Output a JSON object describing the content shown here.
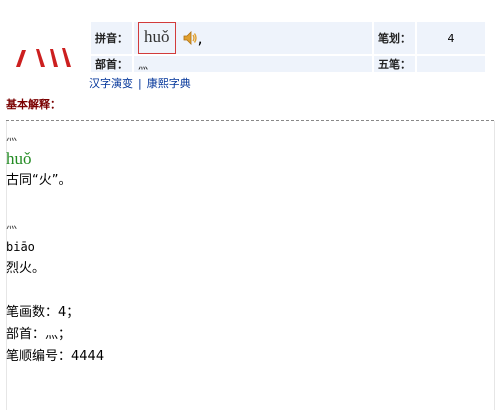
{
  "header": {
    "glyph_color": "#cc1f1f",
    "pinyin_label": "拼音：",
    "pinyin_value": "huǒ",
    "pinyin_suffix": ",",
    "bihua_label": "笔划：",
    "bihua_value": "4",
    "bushou_label": "部首：",
    "bushou_value": "灬",
    "wubi_label": "五笔：",
    "wubi_value": ""
  },
  "links": {
    "evolution": "汉字演变",
    "separator": "|",
    "kangxi": "康熙字典"
  },
  "section_title": "基本解释：",
  "entries": [
    {
      "radical": "灬",
      "pinyin": "huǒ",
      "definition": "古同“火”。"
    },
    {
      "radical": "灬",
      "pinyin": "biāo",
      "definition": "烈火。"
    }
  ],
  "footer": {
    "strokes": "笔画数：4；",
    "radical": "部首：灬；",
    "order": "笔顺编号：4444"
  },
  "icons": {
    "speaker": "speaker-icon"
  }
}
